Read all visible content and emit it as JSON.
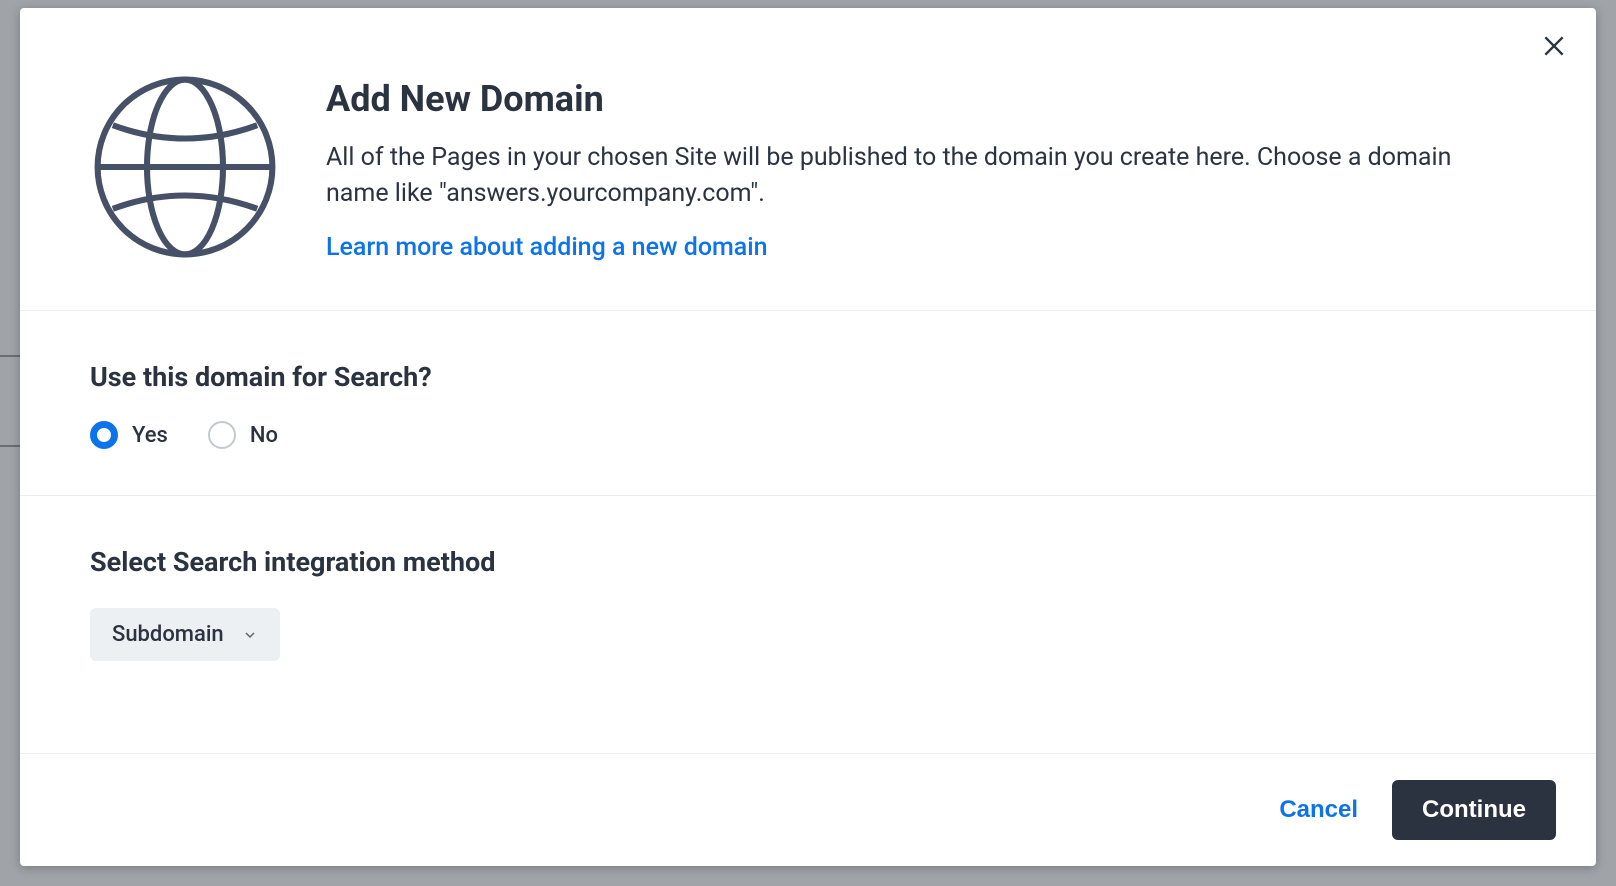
{
  "header": {
    "title": "Add New Domain",
    "description": "All of the Pages in your chosen Site will be published to the domain you create here. Choose a domain name like \"answers.yourcompany.com\".",
    "learn_more": "Learn more about adding a new domain"
  },
  "search_section": {
    "label": "Use this domain for Search?",
    "options": {
      "yes": "Yes",
      "no": "No"
    },
    "selected": "yes"
  },
  "integration_section": {
    "label": "Select Search integration method",
    "dropdown_value": "Subdomain"
  },
  "footer": {
    "cancel": "Cancel",
    "continue": "Continue"
  }
}
